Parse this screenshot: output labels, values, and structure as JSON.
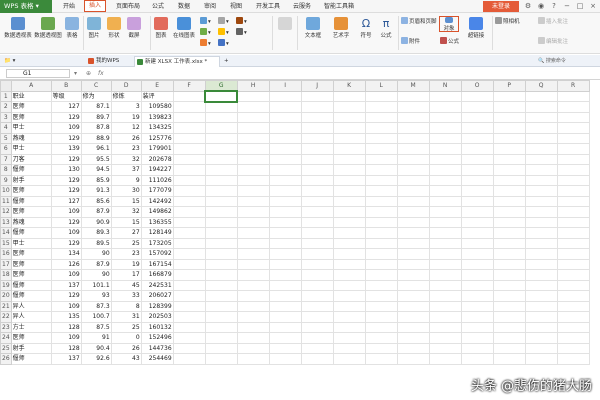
{
  "app": {
    "name": "WPS 表格",
    "brand_color": "#3b8a3b",
    "accent": "#e45b38"
  },
  "menu": {
    "tabs": [
      "开始",
      "插入",
      "页面布局",
      "公式",
      "数据",
      "审阅",
      "视图",
      "开发工具",
      "云服务",
      "智能工具箱"
    ],
    "active": "插入",
    "login": "未登录"
  },
  "ribbon": {
    "large": [
      "数据透视表",
      "数据透视图",
      "表格",
      "图片",
      "形状",
      "截屏",
      "图表",
      "在线图表",
      "文本框",
      "艺术字",
      "符号",
      "公式",
      "页眉和页脚",
      "附件",
      "对象",
      "超链接",
      "照相机"
    ],
    "small": [
      "插入批注",
      "编辑批注"
    ]
  },
  "docbar": {
    "tabs": [
      "我的WPS",
      "新建 XLSX 工作表.xlsx *"
    ],
    "search_placeholder": "搜索命令"
  },
  "formula_bar": {
    "cell": "G1",
    "fx": "fx",
    "value": ""
  },
  "sheet": {
    "columns": [
      "A",
      "B",
      "C",
      "D",
      "E",
      "F",
      "G",
      "H",
      "I",
      "J",
      "K",
      "L",
      "M",
      "N",
      "O",
      "P",
      "Q",
      "R"
    ],
    "selected_cell": "G1",
    "rows": [
      [
        "职业",
        "等级",
        "修为",
        "修炼",
        "装评"
      ],
      [
        "医师",
        "127",
        "87.1",
        "3",
        "109580"
      ],
      [
        "医师",
        "129",
        "89.7",
        "19",
        "139823"
      ],
      [
        "甲士",
        "109",
        "87.8",
        "12",
        "134325"
      ],
      [
        "燕魂",
        "129",
        "88.9",
        "26",
        "125776"
      ],
      [
        "甲士",
        "139",
        "96.1",
        "23",
        "179901"
      ],
      [
        "刀客",
        "129",
        "95.5",
        "32",
        "202678"
      ],
      [
        "偃师",
        "130",
        "94.5",
        "37",
        "194227"
      ],
      [
        "射手",
        "129",
        "85.9",
        "9",
        "111026"
      ],
      [
        "医师",
        "129",
        "91.3",
        "30",
        "177079"
      ],
      [
        "偃师",
        "127",
        "85.6",
        "15",
        "142492"
      ],
      [
        "医师",
        "109",
        "87.9",
        "32",
        "149862"
      ],
      [
        "燕魂",
        "129",
        "90.9",
        "15",
        "136355"
      ],
      [
        "偃师",
        "109",
        "89.3",
        "27",
        "128149"
      ],
      [
        "甲士",
        "129",
        "89.5",
        "25",
        "173205"
      ],
      [
        "医师",
        "134",
        "90",
        "23",
        "157092"
      ],
      [
        "医师",
        "126",
        "87.9",
        "19",
        "167154"
      ],
      [
        "医师",
        "109",
        "90",
        "17",
        "166879"
      ],
      [
        "偃师",
        "137",
        "101.1",
        "45",
        "242531"
      ],
      [
        "偃师",
        "129",
        "93",
        "33",
        "206027"
      ],
      [
        "异人",
        "109",
        "87.3",
        "8",
        "128399"
      ],
      [
        "异人",
        "135",
        "100.7",
        "31",
        "202503"
      ],
      [
        "方士",
        "128",
        "87.5",
        "25",
        "160132"
      ],
      [
        "医师",
        "109",
        "91",
        "0",
        "152496"
      ],
      [
        "射手",
        "128",
        "90.4",
        "26",
        "144736"
      ],
      [
        "偃师",
        "137",
        "92.6",
        "43",
        "254469"
      ]
    ]
  },
  "watermark": "头条 @悲伤的猪大肠"
}
